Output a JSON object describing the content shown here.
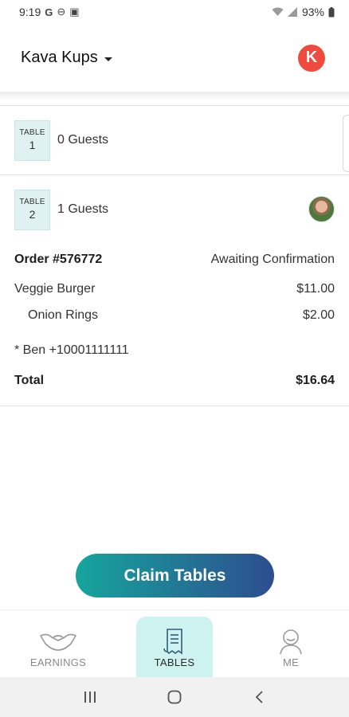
{
  "status_bar": {
    "time": "9:19",
    "battery": "93%"
  },
  "header": {
    "store_name": "Kava Kups",
    "logo_letter": "K"
  },
  "tables": [
    {
      "badge_word": "TABLE",
      "number": "1",
      "guests": "0 Guests"
    },
    {
      "badge_word": "TABLE",
      "number": "2",
      "guests": "1 Guests",
      "order": {
        "id": "Order #576772",
        "status": "Awaiting Confirmation",
        "items": [
          {
            "name": "Veggie Burger",
            "price": "$11.00"
          },
          {
            "name": "Onion Rings",
            "price": "$2.00"
          }
        ],
        "note": "* Ben +10001111111",
        "total_label": "Total",
        "total_value": "$16.64"
      }
    }
  ],
  "claim_button": "Claim Tables",
  "bottom_nav": {
    "earnings": "EARNINGS",
    "tables": "TABLES",
    "me": "ME",
    "active": "tables"
  },
  "colors": {
    "accent_teal": "#16a59c",
    "accent_blue": "#2d4d8f",
    "logo_red": "#ef4a3e",
    "badge_bg": "#dff2f1",
    "nav_active_bg": "#cdf2ef"
  },
  "icons": [
    "google-icon",
    "do-not-disturb-icon",
    "calendar-icon",
    "wifi-icon",
    "signal-icon",
    "battery-icon",
    "caret-down-icon",
    "heart-hands-icon",
    "receipt-icon",
    "person-icon",
    "recents-icon",
    "home-icon",
    "back-icon"
  ]
}
